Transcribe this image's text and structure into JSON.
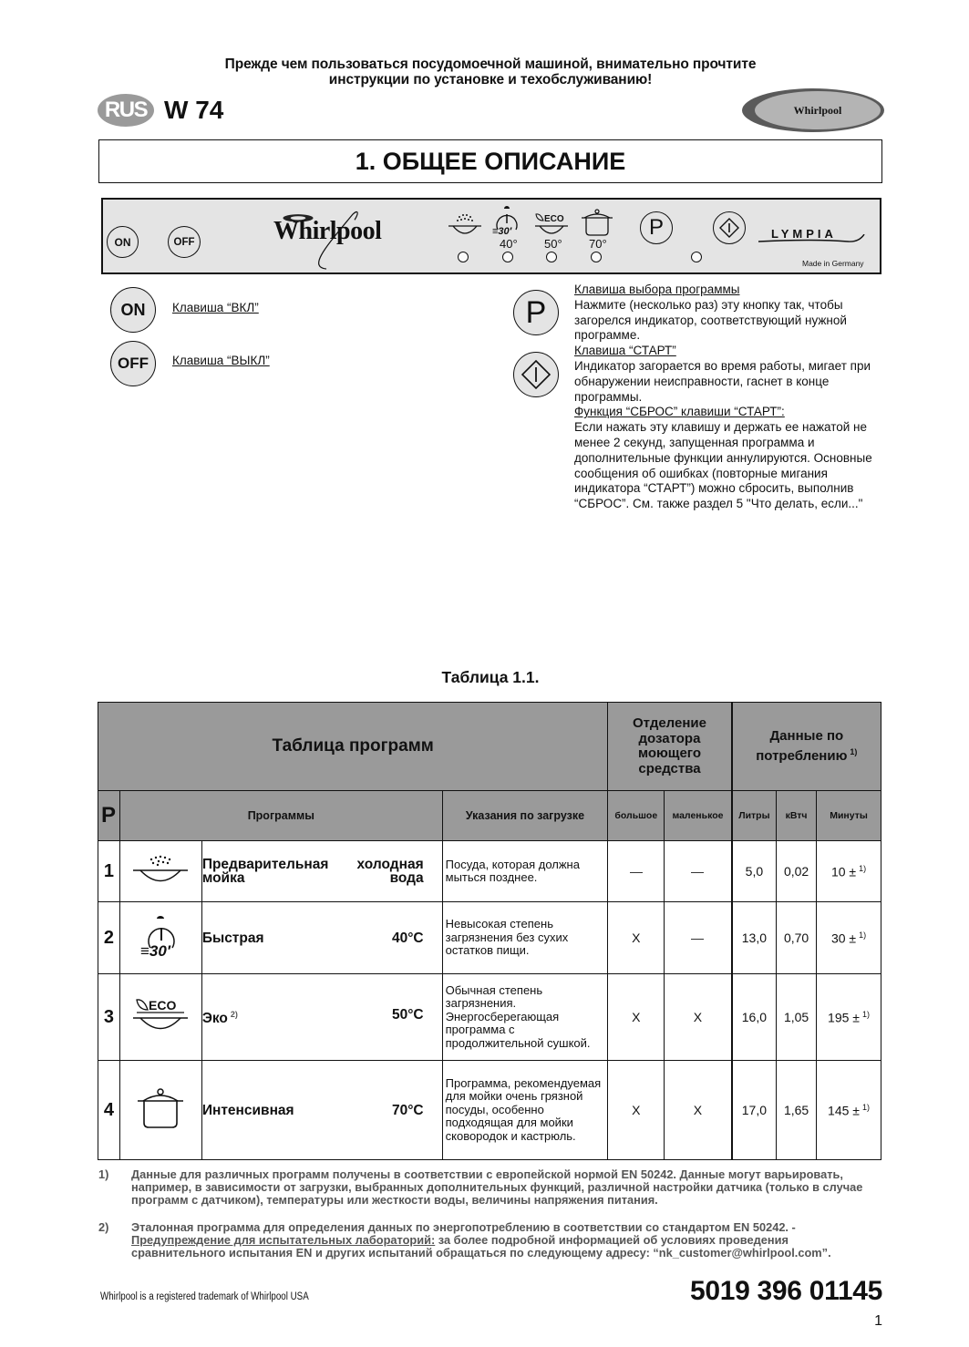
{
  "header": {
    "warning_line1": "Прежде чем пользоваться посудомоечной машиной, внимательно прочтите",
    "warning_line2": "инструкции по установке и техобслуживанию!",
    "language_badge": "RUS",
    "model": "W 74",
    "brand_logo": "Whirlpool"
  },
  "section": {
    "title": "1. ОБЩЕЕ ОПИСАНИЕ"
  },
  "control_panel": {
    "on_label": "ON",
    "off_label": "OFF",
    "brand": "Whirlpool",
    "program_icons": [
      "prewash-icon",
      "quick-30-icon",
      "eco-icon",
      "intensive-pot-icon"
    ],
    "temps": [
      "40°",
      "50°",
      "70°"
    ],
    "p_label": "P",
    "series_logo": "LYMPIA",
    "made_in": "Made in Germany"
  },
  "keys": {
    "on": {
      "button": "ON",
      "label": "Клавиша “ВКЛ”"
    },
    "off": {
      "button": "OFF",
      "label": "Клавиша “ВЫКЛ”"
    },
    "program": {
      "button": "P",
      "title": "Клавиша выбора программы",
      "text": "Нажмите (несколько раз) эту кнопку так, чтобы загорелся индикатор, соответствующий нужной программе."
    },
    "start": {
      "title": "Клавиша “СТАРТ”",
      "text": "Индикатор загорается во время работы, мигает при обнаружении неисправности, гаснет в конце программы.",
      "reset_title": "Функция “СБРОС” клавиши “СТАРТ”:",
      "reset_text": "Если нажать эту клавишу и держать ее нажатой не менее 2 секунд, запущенная программа и дополнительные функции аннулируются. Основные сообщения об ошибках (повторные мигания индикатора “СТАРТ”) можно сбросить, выполнив “СБРОС”. См. также раздел 5 \"Что делать, если...\""
    }
  },
  "table": {
    "caption": "Таблица 1.1.",
    "title": "Таблица программ",
    "detergent_group": "Отделение дозатора моющего средства",
    "consumption_group": "Данные по потреблению",
    "consumption_note": "1)",
    "columns": {
      "p": "P",
      "programs": "Программы",
      "loading": "Указания по загрузке",
      "large": "большое",
      "small": "маленькое",
      "liters": "Литры",
      "kwh": "кВтч",
      "minutes": "Минуты"
    },
    "rows": [
      {
        "num": "1",
        "icon": "prewash-icon",
        "name_line1": "Предварительная",
        "name_line2": "мойка",
        "temp_line1": "холодная",
        "temp_line2": "вода",
        "note": "",
        "loading": "Посуда, которая должна мыться позднее.",
        "large": "—",
        "small": "—",
        "liters": "5,0",
        "kwh": "0,02",
        "minutes": "10 ±",
        "minutes_note": "1)"
      },
      {
        "num": "2",
        "icon": "quick-30-icon",
        "name_line1": "Быстрая",
        "name_line2": "",
        "temp_line1": "40°C",
        "temp_line2": "",
        "note": "",
        "loading": "Невысокая степень загрязнения без сухих остатков пищи.",
        "large": "X",
        "small": "—",
        "liters": "13,0",
        "kwh": "0,70",
        "minutes": "30 ±",
        "minutes_note": "1)"
      },
      {
        "num": "3",
        "icon": "eco-icon",
        "name_line1": "Эко",
        "name_line2": "",
        "temp_line1": "50°C",
        "temp_line2": "",
        "note": "2)",
        "loading": "Обычная степень загрязнения. Энергосберегающая программа с продолжительной сушкой.",
        "large": "X",
        "small": "X",
        "liters": "16,0",
        "kwh": "1,05",
        "minutes": "195 ±",
        "minutes_note": "1)"
      },
      {
        "num": "4",
        "icon": "intensive-pot-icon",
        "name_line1": "Интенсивная",
        "name_line2": "",
        "temp_line1": "70°C",
        "temp_line2": "",
        "note": "",
        "loading": "Программа, рекомендуемая для мойки очень грязной посуды, особенно подходящая для мойки сковородок и кастрюль.",
        "large": "X",
        "small": "X",
        "liters": "17,0",
        "kwh": "1,65",
        "minutes": "145 ±",
        "minutes_note": "1)"
      }
    ]
  },
  "footnotes": [
    {
      "mark": "1)",
      "text": "Данные для различных программ получены в соответствии с европейской нормой EN 50242. Данные могут варьировать, например,  в зависимости от загрузки, выбранных дополнительных функций, различной настройки датчика (только в случае программ с датчиком), температуры или жесткости воды, величины напряжения питания."
    },
    {
      "mark": "2)",
      "text_before": "Эталонная программа для определения данных по энергопотреблению в соответствии со стандартом EN 50242. - ",
      "underlined": "Предупреждение для испытательных лабораторий:",
      "text_after": " за более подробной информацией об условиях проведения сравнительного испытания EN и других испытаний обращаться по следующему адресу: “nk_customer@whirlpool.com”."
    }
  ],
  "footer": {
    "trademark": "Whirlpool is a registered trademark of Whirlpool USA",
    "doc_number": "5019 396 01145",
    "page": "1"
  }
}
